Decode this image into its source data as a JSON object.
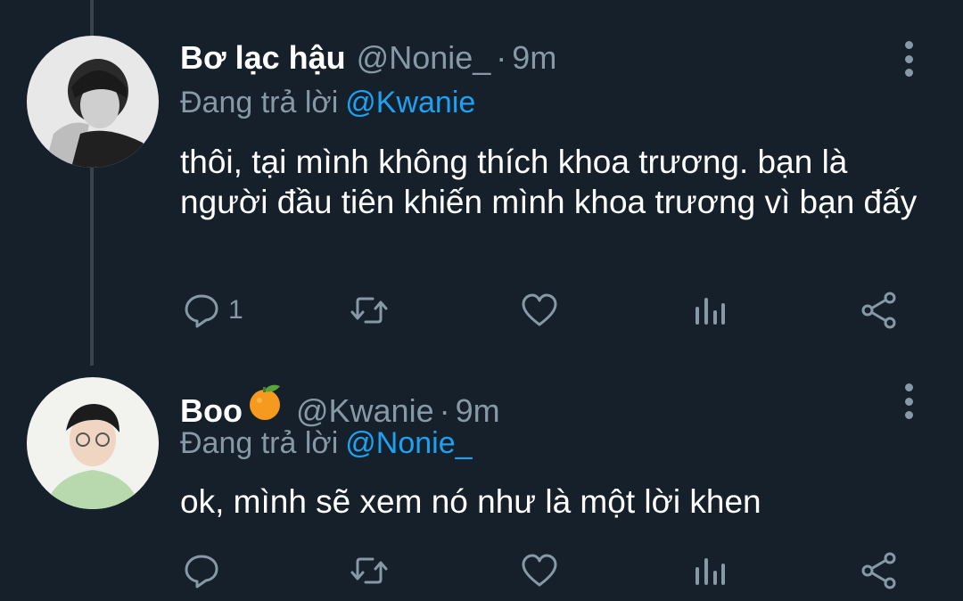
{
  "tweets": [
    {
      "display_name": "Bơ lạc hậu",
      "handle": "@Nonie_",
      "separator": "·",
      "time": "9m",
      "reply_prefix": "Đang trả lời",
      "reply_mention": "@Kwanie",
      "text": "thôi, tại mình không thích khoa trương. bạn là người đầu tiên khiến mình khoa trương vì bạn đấy",
      "reply_count": "1",
      "avatar": "grayscale-photo-avatar"
    },
    {
      "display_name": "Boo",
      "name_emoji": "tangerine-emoji",
      "handle": "@Kwanie",
      "separator": "·",
      "time": "9m",
      "reply_prefix": "Đang trả lời",
      "reply_mention": "@Nonie_",
      "text": "ok, mình sẽ xem nó như là một lời khen",
      "reply_count": "",
      "avatar": "color-photo-avatar"
    }
  ],
  "colors": {
    "background": "#15202b",
    "muted": "#8899a6",
    "accent": "#1da1f2",
    "thread_line": "#38444d"
  },
  "icons": [
    "reply-icon",
    "retweet-icon",
    "like-icon",
    "analytics-icon",
    "share-icon",
    "more-options-icon"
  ]
}
